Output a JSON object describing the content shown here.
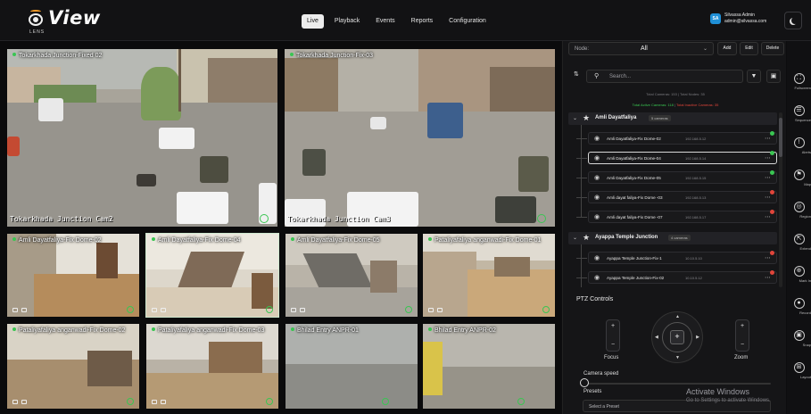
{
  "app": {
    "logo_text": "View",
    "logo_sub": "LENS"
  },
  "nav": {
    "items": [
      "Live",
      "Playback",
      "Events",
      "Reports",
      "Configuration"
    ],
    "active": "Live"
  },
  "user": {
    "initials": "SA",
    "name": "Silvassa Admin",
    "email": "admin@silvassa.com"
  },
  "cameras": [
    {
      "title": "Tokarkhada Junction-Fixed 02",
      "timestamp": "2025-02-0",
      "osd": "Tokarkhada Junction Cam2"
    },
    {
      "title": "Tokarkhada Junction-Fix-03",
      "timestamp": "2025-02-0",
      "osd": "Tokarkhada Junction Cam3"
    },
    {
      "title": "Amli Dayatfaliya-Fix Dome-02"
    },
    {
      "title": "Amli Dayatfaliya-Fix Dome-04"
    },
    {
      "title": "Amli Dayatfaliya-Fix Dome-05"
    },
    {
      "title": "Pataliyafaliya anganwadi-Fix Dome-01"
    },
    {
      "title": "Pataliyafaliya anganwadi-Fix Dome-02"
    },
    {
      "title": "Pataliyafaliya anganwadi-Fix Dome-03"
    },
    {
      "title": "Bhilad Entry ANPR-01"
    },
    {
      "title": "Bhilad Entry ANPR-02"
    }
  ],
  "panel": {
    "node_label": "Node:",
    "node_value": "All",
    "add": "Add",
    "edit": "Edit",
    "delete": "Delete",
    "search_placeholder": "Search...",
    "stats_line1": "Total Cameras: 153  |  Total Nodes: 35",
    "stats_active": "Total Active Cameras: 118",
    "stats_sep": "  |  ",
    "stats_inactive": "Total Inactive Cameras: 35",
    "groups": [
      {
        "name": "Amli Dayatfaliya",
        "badge": "5 cameras",
        "items": [
          {
            "name": "Amli Dayatfaliya-Fix Dome-02",
            "ip": "192.168.5.12",
            "status": "green"
          },
          {
            "name": "Amli Dayatfaliya-Fix Dome-04",
            "ip": "192.168.5.14",
            "status": "green"
          },
          {
            "name": "Amli Dayatfaliya-Fix Dome-05",
            "ip": "192.168.5.15",
            "status": "green"
          },
          {
            "name": "Amli dayat faliya-Fix Dome -03",
            "ip": "192.168.5.13",
            "status": "red"
          },
          {
            "name": "Amli dayat faliya-Fix Dome -07",
            "ip": "192.168.5.17",
            "status": "red"
          }
        ]
      },
      {
        "name": "Ayappa Temple Junction",
        "badge": "4 cameras",
        "items": [
          {
            "name": "Ayappa Temple Junction-Fix-1",
            "ip": "10.10.5.10",
            "status": "red"
          },
          {
            "name": "Ayappa Temple Junction-Fix-02",
            "ip": "10.10.5.12",
            "status": "red"
          }
        ]
      }
    ],
    "ptz_title": "PTZ Controls",
    "focus_label": "Focus",
    "zoom_label": "Zoom",
    "speed_label": "Camera speed",
    "presets_label": "Presets",
    "preset_placeholder": "Select a Preset"
  },
  "toolbar": [
    "Fullscreen",
    "Sequence",
    "Alerts",
    "Map",
    "Region",
    "Extend",
    "Mark In",
    "Record",
    "Snap",
    "Layout"
  ],
  "watermark": {
    "line1": "Activate Windows",
    "line2": "Go to Settings to activate Windows."
  },
  "colors": {
    "accent_green": "#3ac552",
    "accent_red": "#e0453a",
    "avatar_blue": "#1f8fd6",
    "logo_orange": "#f29b28"
  }
}
